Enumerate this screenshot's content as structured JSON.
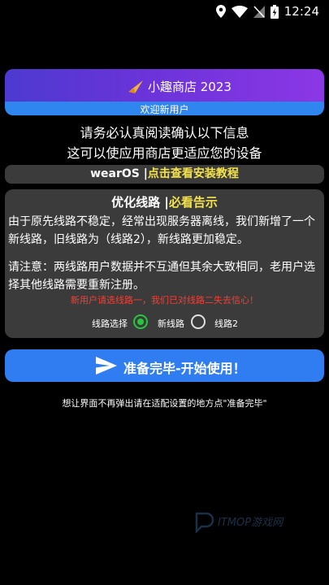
{
  "status_bar": {
    "time": "12:24",
    "icons": [
      "location-icon",
      "wifi-icon",
      "no-sim-icon",
      "battery-charging-icon"
    ]
  },
  "banner": {
    "title": "小趣商店 2023",
    "subtitle": "欢迎新用户",
    "logo": "paper-plane-logo"
  },
  "notice": {
    "line1": "请务必认真阅读确认以下信息",
    "line2": "这可以使应用商店更适应您的设备"
  },
  "wear_bar": {
    "prefix": "wearOS |",
    "link": "点击查看安装教程"
  },
  "panel": {
    "title_prefix": "优化线路 |",
    "title_link": "必看告示",
    "paragraph1": "由于原先线路不稳定，经常出现服务器离线，我们新增了一个新线路，旧线路为（线路2），新线路更加稳定。",
    "paragraph2": "请注意：两线路用户数据并不互通但其余大致相同，老用户选择其他线路需要重新注册。",
    "warning": "新用户请选线路一，我们已对线路二失去信心！",
    "choice_label": "线路选择",
    "options": [
      {
        "label": "新线路",
        "selected": true
      },
      {
        "label": "线路2",
        "selected": false
      }
    ]
  },
  "start_button": {
    "label": "准备完毕-开始使用！",
    "icon": "send-icon"
  },
  "hint": "想让界面不再弹出请在适配设置的地方点\"准备完毕\"",
  "watermark": "ITMOP游戏网",
  "colors": {
    "accent_blue": "#2f7df0",
    "banner_purple": "#6b33d9",
    "link_yellow": "#f4e24a",
    "warning_red": "#ff3b30",
    "radio_green": "#26c640",
    "panel_gray": "#3b3b3b"
  }
}
